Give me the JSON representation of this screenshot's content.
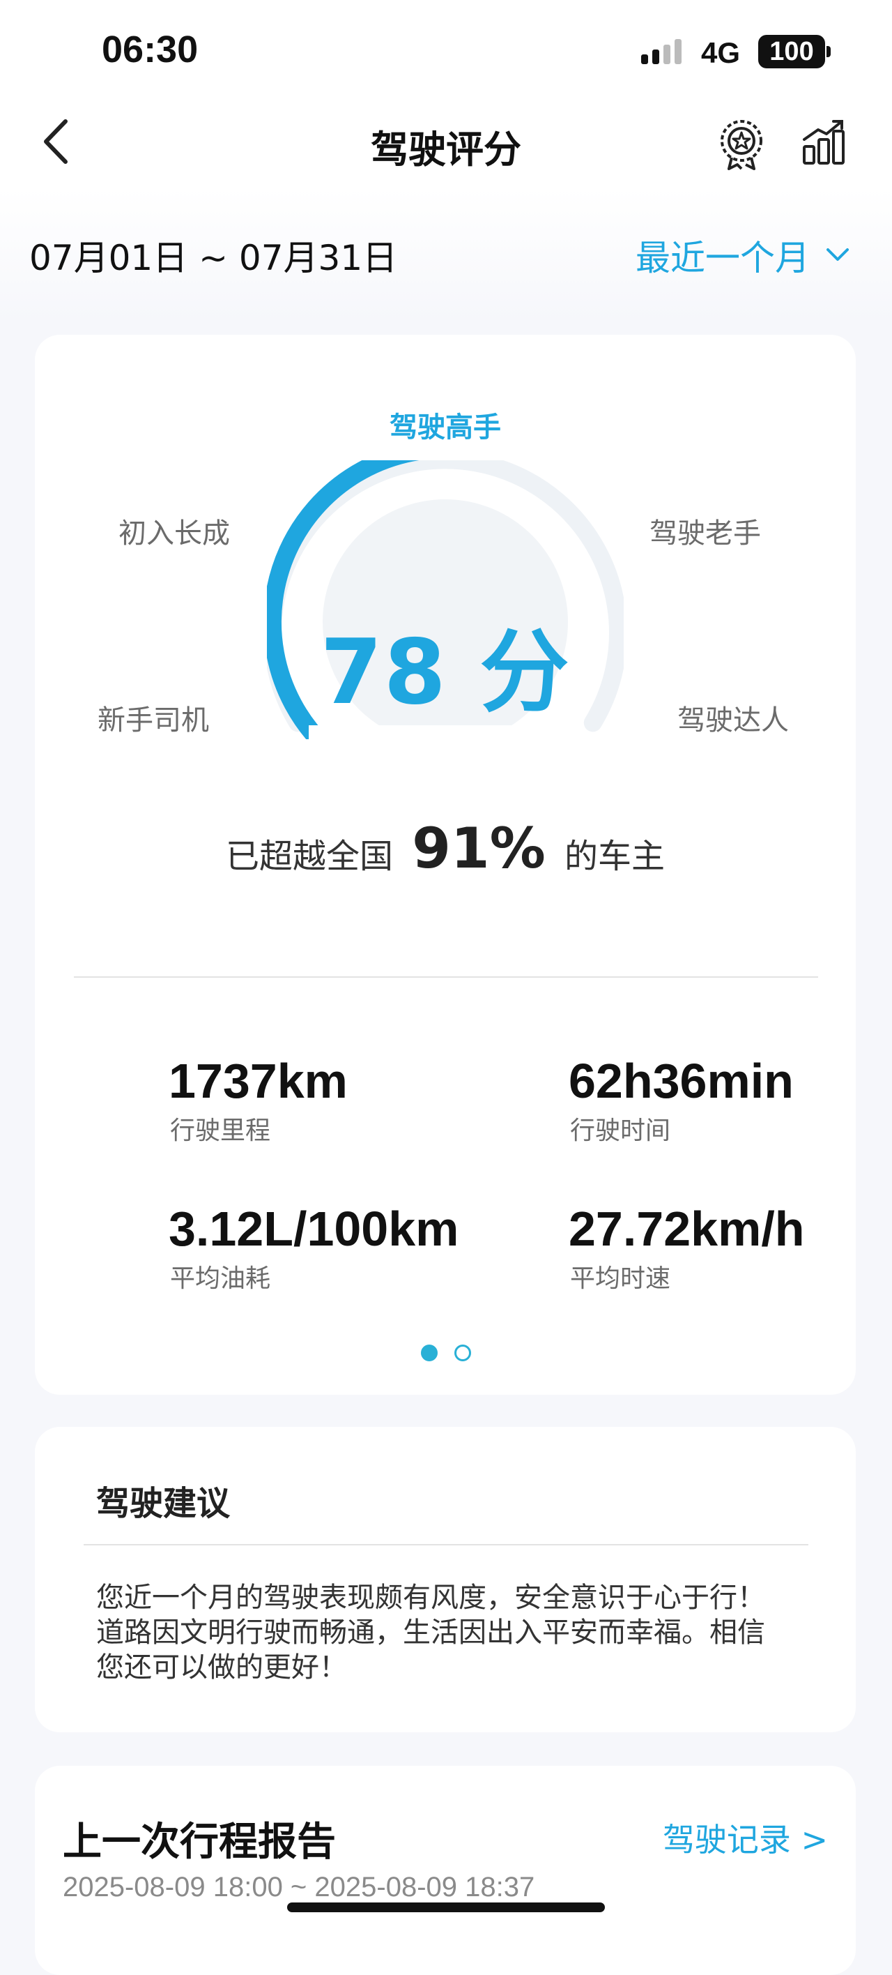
{
  "status_bar": {
    "time": "06:30",
    "network": "4G",
    "battery": "100"
  },
  "nav": {
    "title": "驾驶评分",
    "icons": [
      "back-icon",
      "award-icon",
      "bar-chart-icon"
    ]
  },
  "date_filter": {
    "range": "07月01日 ~ 07月31日",
    "period": "最近一个月"
  },
  "score_card": {
    "levels": {
      "top": "驾驶高手",
      "upper_left": "初入长成",
      "upper_right": "驾驶老手",
      "lower_left": "新手司机",
      "lower_right": "驾驶达人"
    },
    "score": "78 分",
    "score_value": 78,
    "rank_prefix": "已超越全国",
    "rank_percent": "91%",
    "rank_suffix": "的车主",
    "stats": [
      {
        "value": "1737km",
        "label": "行驶里程"
      },
      {
        "value": "62h36min",
        "label": "行驶时间"
      },
      {
        "value": "3.12L/100km",
        "label": "平均油耗"
      },
      {
        "value": "27.72km/h",
        "label": "平均时速"
      }
    ],
    "page_count": 2,
    "active_page": 1
  },
  "advice": {
    "title": "驾驶建议",
    "lines": [
      "您近一个月的驾驶表现颇有风度，安全意识于心于行！",
      "道路因文明行驶而畅通，生活因出入平安而幸福。相信",
      "您还可以做的更好！"
    ]
  },
  "trip_report": {
    "title": "上一次行程报告",
    "link": "驾驶记录 >",
    "time_range": "2025-08-09 18:00 ~ 2025-08-09 18:37"
  },
  "colors": {
    "accent": "#1fa6df",
    "gauge_track": "#eef2f6",
    "gauge_inner": "#f1f4f7"
  }
}
